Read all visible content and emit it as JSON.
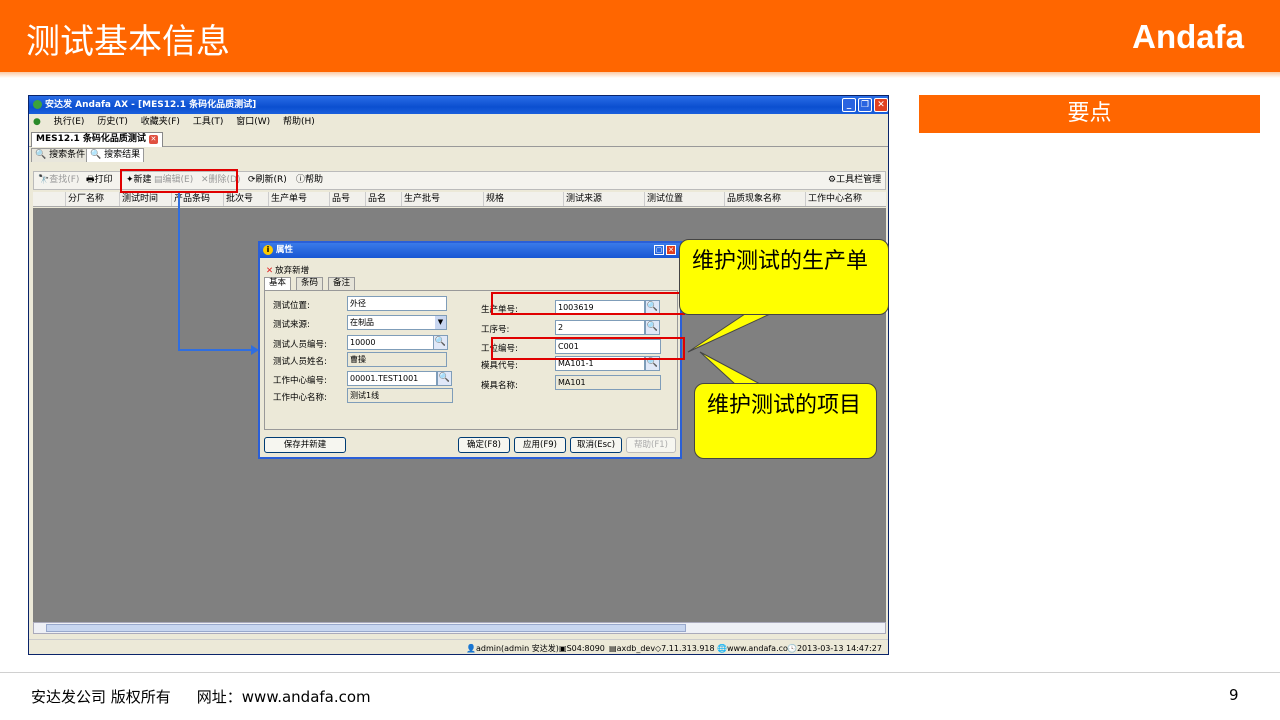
{
  "slide": {
    "title": "测试基本信息",
    "brand": "Andafa",
    "keypoint_label": "要点",
    "footer_company": "安达发公司 版权所有",
    "footer_site": "网址：www.andafa.com",
    "page_number": "9"
  },
  "window": {
    "title": "安达发 Andafa AX - [MES12.1 条码化品质测试]",
    "controls": [
      "minimize-icon",
      "restore-icon",
      "close-icon"
    ],
    "menu": [
      "执行(E)",
      "历史(T)",
      "收藏夹(F)",
      "工具(T)",
      "窗口(W)",
      "帮助(H)"
    ],
    "doc_tab": "MES12.1 条码化品质测试",
    "sub_tabs": [
      "搜索条件",
      "搜索结果"
    ],
    "toolbar": {
      "find": "查找(F)",
      "print": "打印",
      "new": "新建",
      "edit": "编辑(E)",
      "delete": "删除(D)",
      "refresh": "刷新(R)",
      "help": "帮助",
      "manage": "工具栏管理"
    },
    "grid_columns": [
      "分厂名称",
      "测试时间",
      "产品条码",
      "批次号",
      "生产单号",
      "品号",
      "品名",
      "生产批号",
      "规格",
      "测试来源",
      "测试位置",
      "品质现象名称",
      "工作中心名称"
    ],
    "status": {
      "user": "admin(admin 安达发)",
      "server": "S04:8090",
      "db": "axdb_dev",
      "version": "7.11.313.918",
      "site": "www.andafa.com",
      "datetime": "2013-03-13 14:47:27"
    }
  },
  "dialog": {
    "title": "属性",
    "discard": "放弃新增",
    "tabs": [
      "基本",
      "条码",
      "备注"
    ],
    "labels": {
      "test_position": "测试位置:",
      "test_source": "测试来源:",
      "tester_id": "测试人员编号:",
      "tester_name": "测试人员姓名:",
      "wc_id": "工作中心编号:",
      "wc_name": "工作中心名称:",
      "order_no": "生产单号:",
      "op_no": "工序号:",
      "step_no": "工位编号:",
      "mold_code": "模具代号:",
      "mold_name": "模具名称:"
    },
    "values": {
      "test_position": "外径",
      "test_source": "在制品",
      "tester_id": "10000",
      "tester_name": "曹操",
      "wc_id": "00001.TEST1001",
      "wc_name": "测试1线",
      "order_no": "1003619",
      "op_no": "2",
      "step_no": "C001",
      "mold_code": "MA101-1",
      "mold_name": "MA101"
    },
    "buttons": {
      "save_new": "保存并新建",
      "ok": "确定(F8)",
      "apply": "应用(F9)",
      "cancel": "取消(Esc)",
      "help": "帮助(F1)"
    }
  },
  "callouts": {
    "order": "维护测试的生产单",
    "item": "维护测试的项目"
  },
  "colors": {
    "accent": "#ff6600",
    "callout": "#ffff00",
    "highlight": "#e00000",
    "connector": "#2f6ee0"
  }
}
